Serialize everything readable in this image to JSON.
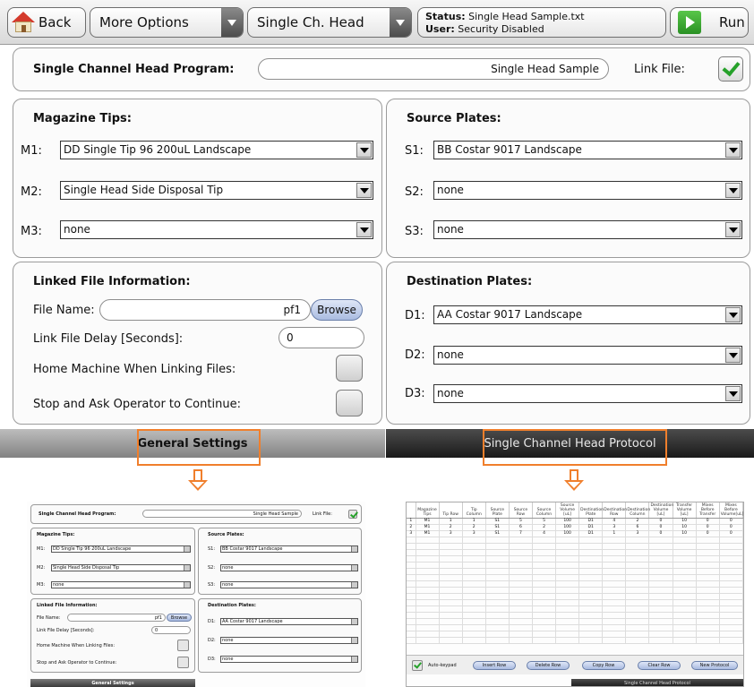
{
  "toolbar": {
    "back_label": "Back",
    "more_options_label": "More Options",
    "head_select_value": "Single Ch. Head",
    "status_key": "Status:",
    "status_value": "Single Head Sample.txt",
    "user_key": "User:",
    "user_value": "Security Disabled",
    "run_label": "Run"
  },
  "program": {
    "label": "Single Channel Head Program:",
    "value": "Single Head Sample",
    "link_file_label": "Link File:",
    "link_file_checked": true
  },
  "magazine_tips": {
    "title": "Magazine Tips:",
    "rows": [
      {
        "label": "M1:",
        "value": "DD Single Tip 96 200uL Landscape"
      },
      {
        "label": "M2:",
        "value": "Single Head Side Disposal Tip"
      },
      {
        "label": "M3:",
        "value": "none"
      }
    ]
  },
  "source_plates": {
    "title": "Source Plates:",
    "rows": [
      {
        "label": "S1:",
        "value": "BB Costar 9017 Landscape"
      },
      {
        "label": "S2:",
        "value": "none"
      },
      {
        "label": "S3:",
        "value": "none"
      }
    ]
  },
  "linked_file": {
    "title": "Linked File Information:",
    "file_name_label": "File Name:",
    "file_name_value": "pf1",
    "browse_label": "Browse",
    "delay_label": "Link File Delay [Seconds]:",
    "delay_value": "0",
    "home_label": "Home Machine When Linking Files:",
    "stop_label": "Stop and Ask Operator to Continue:"
  },
  "destination_plates": {
    "title": "Destination Plates:",
    "rows": [
      {
        "label": "D1:",
        "value": "AA Costar 9017 Landscape"
      },
      {
        "label": "D2:",
        "value": "none"
      },
      {
        "label": "D3:",
        "value": "none"
      }
    ]
  },
  "tabs": {
    "general": "General Settings",
    "protocol": "Single Channel Head Protocol"
  },
  "protocol_table": {
    "headers": [
      "Magazine Tips",
      "Tip Row",
      "Tip Column",
      "Source Plate",
      "Source Row",
      "Source Column",
      "Source Volume [uL]",
      "Destination Plate",
      "Destination Row",
      "Destination Column",
      "Destination Volume [uL]",
      "Transfer Volume [uL]",
      "Mixes Before Transfer",
      "Mixes Before Volume[uL]"
    ],
    "rows": [
      {
        "n": "1",
        "cells": [
          "M1",
          "1",
          "1",
          "S1",
          "5",
          "5",
          "100",
          "D1",
          "4",
          "2",
          "0",
          "10",
          "0",
          "0"
        ]
      },
      {
        "n": "2",
        "cells": [
          "M1",
          "2",
          "2",
          "S1",
          "6",
          "2",
          "100",
          "D1",
          "3",
          "6",
          "0",
          "10",
          "0",
          "0"
        ]
      },
      {
        "n": "3",
        "cells": [
          "M1",
          "3",
          "3",
          "S1",
          "7",
          "4",
          "100",
          "D1",
          "1",
          "3",
          "0",
          "10",
          "0",
          "0"
        ]
      }
    ],
    "auto_keypad_label": "Auto-keypad",
    "buttons": [
      "Insert Row",
      "Delete Row",
      "Copy Row",
      "Clear Row",
      "New Protocol"
    ]
  },
  "colors": {
    "highlight": "#f07f2c",
    "check_green": "#26a12a"
  }
}
